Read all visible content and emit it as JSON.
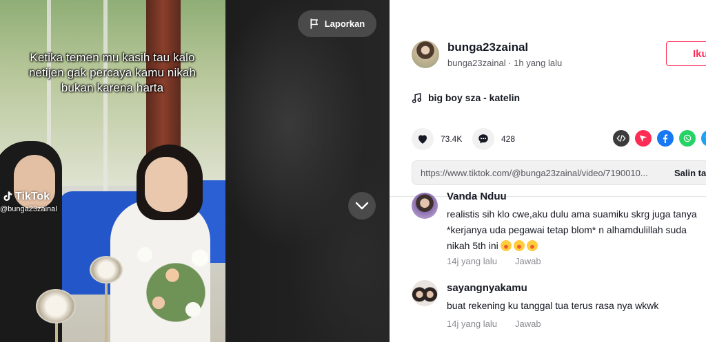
{
  "video": {
    "caption": "Ketika temen mu kasih tau kalo netijen gak percaya kamu nikah bukan karena harta",
    "watermark_logo": "TikTok",
    "watermark_handle": "@bunga23zainal",
    "report_label": "Laporkan"
  },
  "post": {
    "username": "bunga23zainal",
    "subline": "bunga23zainal · 1h yang lalu",
    "follow_label": "Iku",
    "music": "big boy sza - katelin",
    "likes": "73.4K",
    "comments_count": "428",
    "link_url": "https://www.tiktok.com/@bunga23zainal/video/7190010...",
    "copy_label": "Salin ta"
  },
  "share_icons": [
    {
      "icon": "embed-code-icon",
      "color": "#3b3b3b"
    },
    {
      "icon": "send-icon",
      "color": "#fe2c55"
    },
    {
      "icon": "facebook-icon",
      "color": "#1877f2"
    },
    {
      "icon": "whatsapp-icon",
      "color": "#25d366"
    },
    {
      "icon": "twitter-icon",
      "color": "#1da1f2"
    }
  ],
  "comments": [
    {
      "name": "Vanda Nduu",
      "text": "realistis sih klo cwe,aku dulu ama suamiku skrg juga tanya *kerjanya uda pegawai tetap blom* n alhamdulillah suda nikah 5th ini",
      "time": "14j yang lalu",
      "reply": "Jawab"
    },
    {
      "name": "sayangnyakamu",
      "text": "buat rekening ku tanggal tua terus rasa nya wkwk",
      "time": "14j yang lalu",
      "reply": "Jawab"
    }
  ]
}
